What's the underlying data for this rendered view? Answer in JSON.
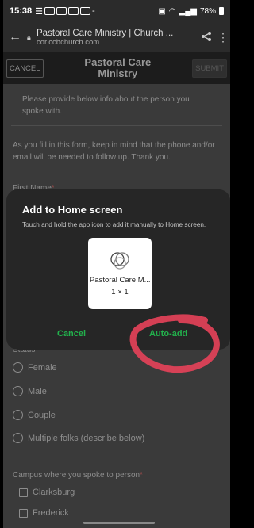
{
  "status_bar": {
    "time": "15:38",
    "battery": "78%"
  },
  "browser": {
    "page_title": "Pastoral Care Ministry | Church ...",
    "url": "cor.ccbchurch.com"
  },
  "form_header": {
    "cancel_label": "CANCEL",
    "title": "Pastoral Care Ministry",
    "submit_label": "SUBMIT"
  },
  "form": {
    "intro_text": "Please provide below info about the person you spoke with.",
    "instructions": "As you fill in this form, keep in mind that the phone and/or email will be needed to follow up.  Thank you.",
    "first_name_label": "First Name",
    "required_mark": "*",
    "status_label": "Status",
    "status_options": [
      "Female",
      "Male",
      "Couple",
      "Multiple folks (describe below)"
    ],
    "campus_label": "Campus where you spoke to person",
    "campus_options": [
      "Clarksburg",
      "Frederick"
    ]
  },
  "dialog": {
    "title": "Add to Home screen",
    "description": "Touch and hold the app icon to add it manually to Home screen.",
    "app_name": "Pastoral Care M...",
    "app_size": "1 × 1",
    "cancel_label": "Cancel",
    "auto_add_label": "Auto-add"
  },
  "colors": {
    "dialog_button": "#22b14c",
    "annotation": "#e8425a"
  }
}
